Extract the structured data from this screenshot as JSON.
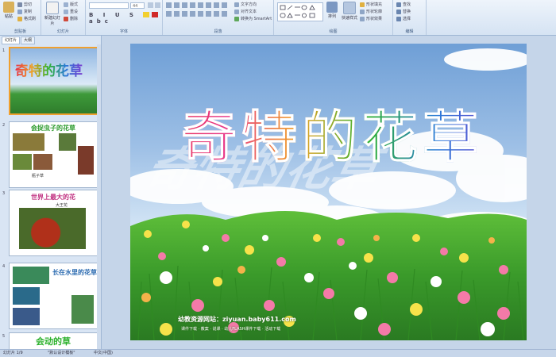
{
  "ribbon": {
    "clipboard": {
      "paste": "粘贴",
      "cut": "剪切",
      "copy": "复制",
      "format_painter": "格式刷",
      "label": "剪贴板"
    },
    "slides": {
      "new_slide": "新建幻灯片",
      "layout": "版式",
      "reset": "重设",
      "delete": "删除",
      "label": "幻灯片"
    },
    "font": {
      "font_name": "",
      "font_size": "44",
      "label": "字体"
    },
    "paragraph": {
      "text_direction": "文字方向",
      "align_text": "对齐文本",
      "smartart": "转换为 SmartArt",
      "label": "段落"
    },
    "drawing": {
      "arrange": "排列",
      "quick_styles": "快速样式",
      "shape_fill": "形状填充",
      "shape_outline": "形状轮廓",
      "shape_effects": "形状效果",
      "label": "绘图"
    },
    "editing": {
      "find": "查找",
      "replace": "替换",
      "select": "选择",
      "label": "编辑"
    }
  },
  "panel": {
    "tabs": [
      "幻灯片",
      "大纲"
    ],
    "slides": [
      {
        "num": "1",
        "title": "奇特的花草"
      },
      {
        "num": "2",
        "title": "会捉虫子的花草",
        "caption": "瓶子草"
      },
      {
        "num": "3",
        "title": "世界上最大的花",
        "caption": "大王花"
      },
      {
        "num": "4",
        "title": "长在水里的花草"
      },
      {
        "num": "5",
        "title": "会动的草"
      }
    ]
  },
  "slide": {
    "title": "奇特的花草",
    "footer": "幼教资源网站：ziyuan.baby611.com",
    "subfooter": "课件下载 · 教案 · 说课 · 幼儿FLASH课件下载 · 活动下载"
  },
  "status": {
    "slide_info": "幻灯片 1/9",
    "theme": "\"默认设计模板\"",
    "language": "中文(中国)"
  },
  "colors": {
    "title_gradient": [
      "#e8324a",
      "#e83a8c",
      "#f0a020",
      "#32b432",
      "#2a7ad8",
      "#7a3ad0"
    ],
    "selection": "#f0a030"
  }
}
